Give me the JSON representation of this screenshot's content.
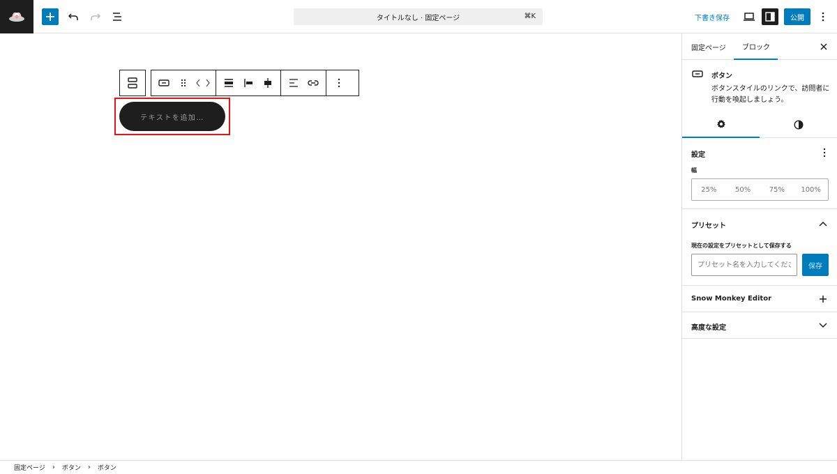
{
  "topbar": {
    "logo_icon": "monkey-flower-logo",
    "add_icon": "plus-icon",
    "undo_icon": "undo-icon",
    "redo_icon": "redo-icon",
    "list_view_icon": "list-view-icon",
    "document_title": "タイトルなし · 固定ページ",
    "shortcut": "⌘K",
    "save_draft_label": "下書き保存",
    "view_icon": "desktop-icon",
    "settings_icon": "sidebar-icon",
    "publish_label": "公開",
    "options_icon": "more-vertical-icon"
  },
  "block_toolbar": {
    "parent_icon": "group-block-icon",
    "items": [
      {
        "group": 1,
        "icon": "button-block-icon"
      },
      {
        "group": 1,
        "icon": "drag-handle-icon"
      },
      {
        "group": 1,
        "icon": "move-arrows-icon"
      },
      {
        "group": 2,
        "icon": "align-full-icon"
      },
      {
        "group": 2,
        "icon": "justify-left-icon"
      },
      {
        "group": 2,
        "icon": "justify-center-icon"
      },
      {
        "group": 3,
        "icon": "text-align-icon"
      },
      {
        "group": 3,
        "icon": "link-icon"
      },
      {
        "group": 4,
        "icon": "more-vertical-icon"
      }
    ]
  },
  "canvas": {
    "button_placeholder": "テキストを追加…"
  },
  "sidebar": {
    "tabs": [
      "固定ページ",
      "ブロック"
    ],
    "active_tab": "ブロック",
    "block_card": {
      "title": "ボタン",
      "description": "ボタンスタイルのリンクで、訪問者に行動を喚起しましょう。"
    },
    "style_tabs": {
      "settings_icon": "gear-icon",
      "styles_icon": "contrast-icon"
    },
    "settings": {
      "title": "設定",
      "width_label": "幅",
      "width_options": [
        "25%",
        "50%",
        "75%",
        "100%"
      ]
    },
    "presets": {
      "title": "プリセット",
      "save_label": "現在の設定をプリセットとして保存する",
      "input_placeholder": "プリセット名を入力してください",
      "save_button": "保存"
    },
    "snow_monkey": {
      "title": "Snow Monkey Editor"
    },
    "advanced": {
      "title": "高度な設定"
    }
  },
  "breadcrumb": [
    "固定ページ",
    "ボタン",
    "ボタン"
  ],
  "colors": {
    "accent": "#007cba",
    "dark": "#1e1e1e",
    "highlight": "#e11111"
  }
}
